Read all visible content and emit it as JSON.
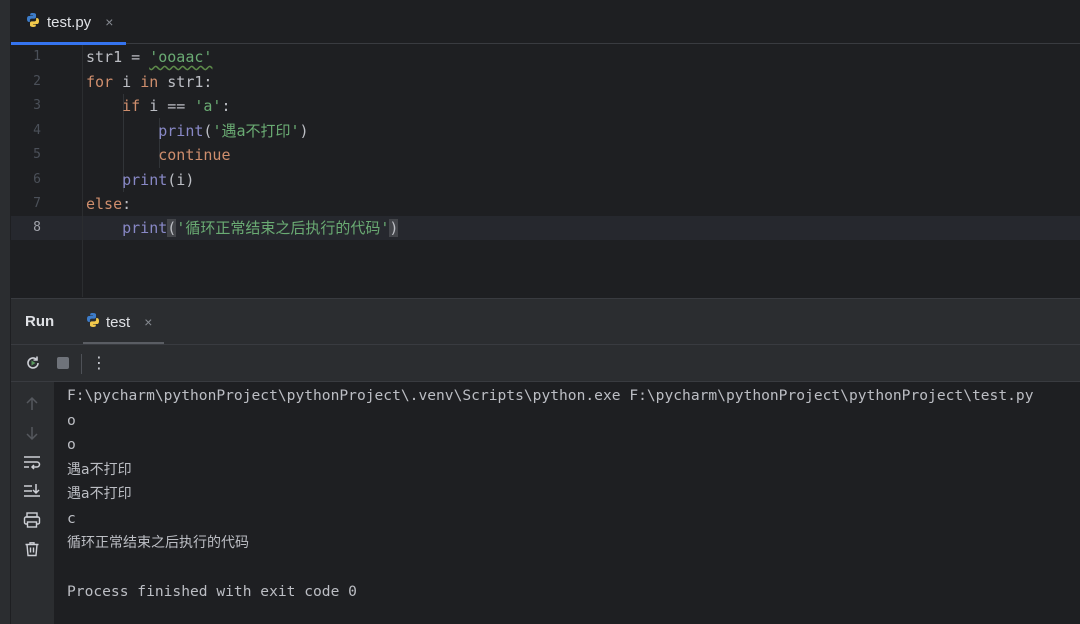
{
  "editor_tab": {
    "label": "test.py",
    "close": "×"
  },
  "editor": {
    "line_numbers": [
      "1",
      "2",
      "3",
      "4",
      "5",
      "6",
      "7",
      "8"
    ],
    "lines": {
      "l1": {
        "a": "str1 = ",
        "b": "'ooaac'"
      },
      "l2": {
        "a": "for",
        "b": " i ",
        "c": "in",
        "d": " str1:"
      },
      "l3": {
        "a": "    ",
        "b": "if",
        "c": " i == ",
        "d": "'a'",
        "e": ":"
      },
      "l4": {
        "a": "        ",
        "b": "print",
        "c": "(",
        "d": "'遇a不打印'",
        "e": ")"
      },
      "l5": {
        "a": "        ",
        "b": "continue"
      },
      "l6": {
        "a": "    ",
        "b": "print",
        "c": "(i)"
      },
      "l7": {
        "a": "else",
        "b": ":"
      },
      "l8": {
        "a": "    ",
        "b": "print",
        "c": "(",
        "d": "'循环正常结束之后执行的代码'",
        "e": ")"
      }
    }
  },
  "run_panel": {
    "title": "Run",
    "tab_label": "test",
    "tab_close": "×",
    "toolbar_more": "⋮"
  },
  "console": {
    "lines": [
      "F:\\pycharm\\pythonProject\\pythonProject\\.venv\\Scripts\\python.exe F:\\pycharm\\pythonProject\\pythonProject\\test.py",
      "o",
      "o",
      "遇a不打印",
      "遇a不打印",
      "c",
      "循环正常结束之后执行的代码",
      "",
      "Process finished with exit code 0"
    ]
  },
  "colors": {
    "background": "#1e1f22",
    "panel": "#2b2d30",
    "accent": "#3574f0",
    "keyword": "#cf8e6d",
    "string": "#6aab73",
    "builtin": "#8888c6"
  }
}
